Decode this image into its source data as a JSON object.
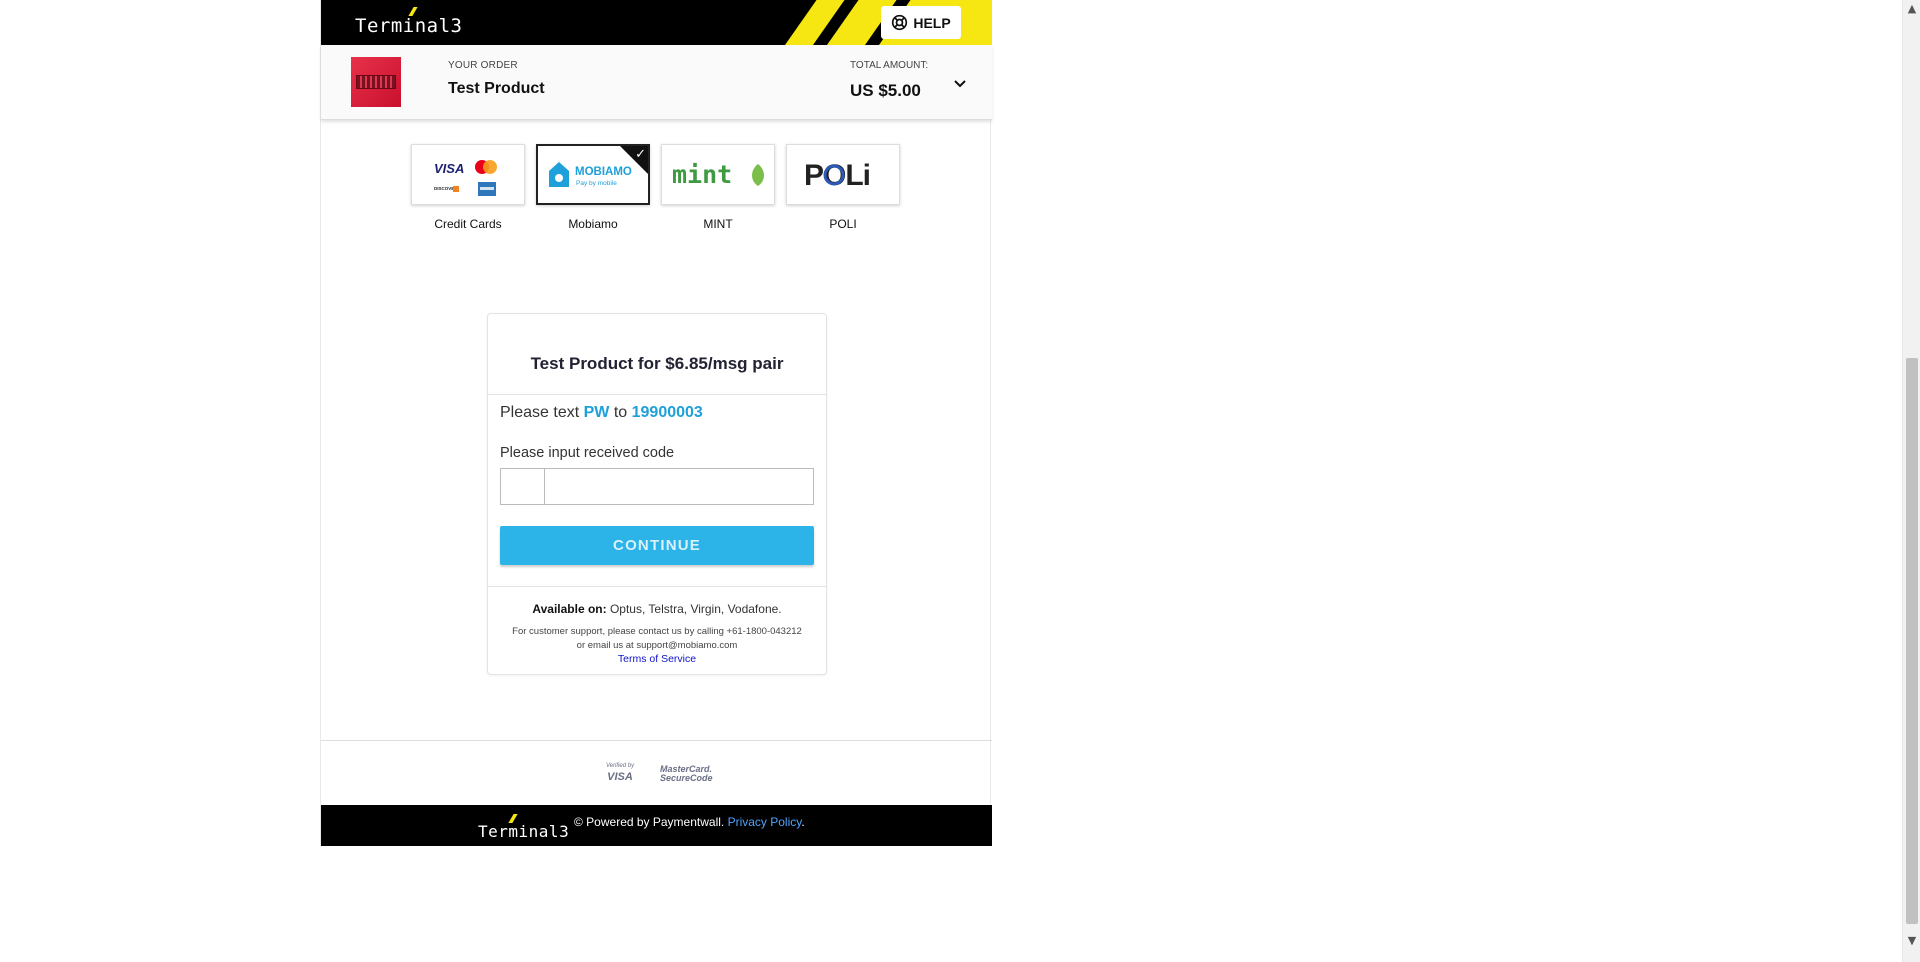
{
  "brand": {
    "logo_text": "Terminal3",
    "accent_color": "#f6e612",
    "bar_color": "#000000"
  },
  "header": {
    "help_label": "HELP"
  },
  "order": {
    "your_order_label": "YOUR ORDER",
    "product_name": "Test Product",
    "total_label": "TOTAL AMOUNT:",
    "total_amount": "US $5.00"
  },
  "payment_methods": [
    {
      "label": "Credit Cards",
      "selected": false
    },
    {
      "label": "Mobiamo",
      "selected": true
    },
    {
      "label": "MINT",
      "selected": false
    },
    {
      "label": "POLI",
      "selected": false
    }
  ],
  "logos": {
    "visa": "VISA",
    "discover": "DISCOVER",
    "mobiamo_name": "MOBIAMO",
    "mobiamo_tagline": "Pay by mobile",
    "mint": "mint",
    "poli": "POLi"
  },
  "panel": {
    "title": "Test Product for $6.85/msg pair",
    "instruction_prefix": "Please text ",
    "keyword": "PW",
    "instruction_mid": " to ",
    "shortcode": "19900003",
    "input_label": "Please input received code",
    "continue_label": "CONTINUE",
    "available_label": "Available on:",
    "carriers": " Optus, Telstra, Virgin, Vodafone.",
    "support_line1": "For customer support, please contact us by calling +61-1800-043212",
    "support_line2": "or email us at support@mobiamo.com",
    "tos_label": "Terms of Service",
    "accent_color": "#1ea0da",
    "button_color": "#2cb4e8"
  },
  "footer": {
    "verified_small": "Verified by",
    "verified_brand": "VISA",
    "mc_line1": "MasterCard.",
    "mc_line2": "SecureCode",
    "powered_text": "© Powered by Paymentwall. ",
    "privacy_label": "Privacy Policy",
    "privacy_suffix": "."
  }
}
